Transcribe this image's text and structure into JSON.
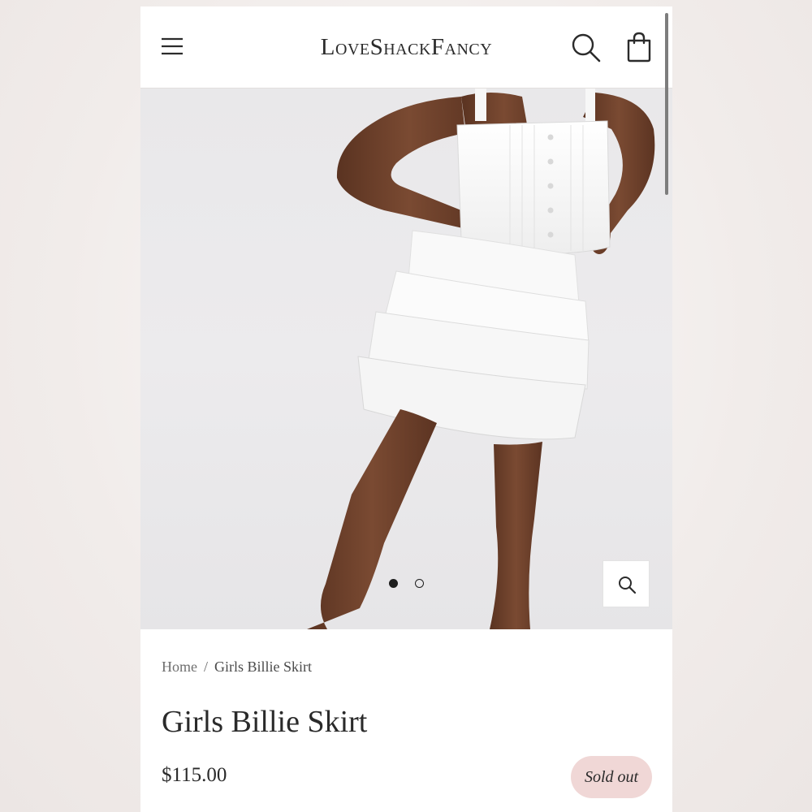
{
  "header": {
    "brand": "LoveShackFancy",
    "menu_icon": "hamburger-menu-icon",
    "search_icon": "search-icon",
    "cart_icon": "shopping-bag-icon"
  },
  "gallery": {
    "image_alt": "Girl wearing white tiered ruffle skirt and white button-front crop top",
    "slides_total": 2,
    "active_slide": 1,
    "zoom_icon": "zoom-search-icon"
  },
  "breadcrumb": {
    "home": "Home",
    "separator": "/",
    "current": "Girls Billie Skirt"
  },
  "product": {
    "title": "Girls Billie Skirt",
    "price": "$115.00",
    "status": "Sold out"
  },
  "colors": {
    "sold_badge_bg": "#f0d7d6",
    "text": "#2a2a2a"
  }
}
